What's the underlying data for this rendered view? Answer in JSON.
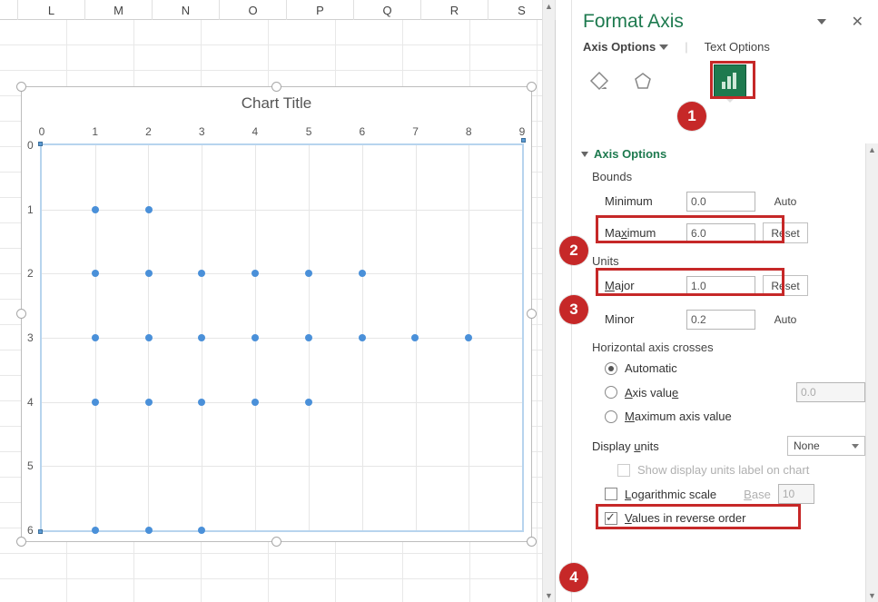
{
  "columns": [
    "L",
    "M",
    "N",
    "O",
    "P",
    "Q",
    "R",
    "S"
  ],
  "chart_title": "Chart Title",
  "chart_data": {
    "type": "scatter",
    "title": "Chart Title",
    "x_ticks": [
      0,
      1,
      2,
      3,
      4,
      5,
      6,
      7,
      8,
      9
    ],
    "y_ticks": [
      0,
      1,
      2,
      3,
      4,
      5,
      6
    ],
    "xlim": [
      0,
      9
    ],
    "ylim": [
      0,
      6
    ],
    "y_reversed": true,
    "points": [
      {
        "x": 1,
        "y": 1
      },
      {
        "x": 2,
        "y": 1
      },
      {
        "x": 1,
        "y": 2
      },
      {
        "x": 2,
        "y": 2
      },
      {
        "x": 3,
        "y": 2
      },
      {
        "x": 4,
        "y": 2
      },
      {
        "x": 5,
        "y": 2
      },
      {
        "x": 6,
        "y": 2
      },
      {
        "x": 1,
        "y": 3
      },
      {
        "x": 2,
        "y": 3
      },
      {
        "x": 3,
        "y": 3
      },
      {
        "x": 4,
        "y": 3
      },
      {
        "x": 5,
        "y": 3
      },
      {
        "x": 6,
        "y": 3
      },
      {
        "x": 7,
        "y": 3
      },
      {
        "x": 8,
        "y": 3
      },
      {
        "x": 1,
        "y": 4
      },
      {
        "x": 2,
        "y": 4
      },
      {
        "x": 3,
        "y": 4
      },
      {
        "x": 4,
        "y": 4
      },
      {
        "x": 5,
        "y": 4
      },
      {
        "x": 1,
        "y": 6
      },
      {
        "x": 2,
        "y": 6
      },
      {
        "x": 3,
        "y": 6
      }
    ]
  },
  "panel": {
    "title": "Format Axis",
    "tab_axis_options": "Axis Options",
    "tab_text_options": "Text Options",
    "section_axis_options": "Axis Options",
    "bounds_label": "Bounds",
    "min_label": "Minimum",
    "min_value": "0.0",
    "min_btn": "Auto",
    "max_label_pre": "Ma",
    "max_label_u": "x",
    "max_label_post": "imum",
    "max_value": "6.0",
    "max_btn": "Reset",
    "units_label": "Units",
    "major_label_u": "M",
    "major_label_post": "ajor",
    "major_value": "1.0",
    "major_btn": "Reset",
    "minor_label": "Minor",
    "minor_value": "0.2",
    "minor_btn": "Auto",
    "hac_label": "Horizontal axis crosses",
    "hac_auto": "Automatic",
    "hac_axis_value": "Axis value",
    "hac_axis_value_input": "0.0",
    "hac_max": "Maximum axis value",
    "display_units_label": "Display units",
    "display_units_value": "None",
    "show_units_label": "Show display units label on chart",
    "log_scale_label": "Logarithmic scale",
    "log_base_label": "Base",
    "log_base_value": "10",
    "reverse_label": "Values in reverse order"
  },
  "callouts": [
    "1",
    "2",
    "3",
    "4"
  ]
}
